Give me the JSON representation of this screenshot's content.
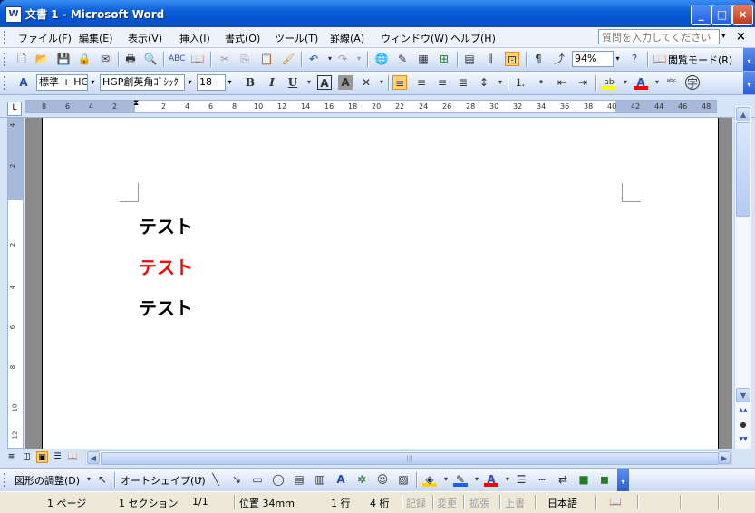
{
  "window": {
    "title": "文書 1 - Microsoft Word",
    "app_icon": "W"
  },
  "titlebar_buttons": {
    "minimize": "_",
    "maximize": "□",
    "close": "×"
  },
  "menu": {
    "items": [
      "ファイル(F)",
      "編集(E)",
      "表示(V)",
      "挿入(I)",
      "書式(O)",
      "ツール(T)",
      "罫線(A)",
      "ウィンドウ(W)",
      "ヘルプ(H)"
    ],
    "ask_placeholder": "質問を入力してください",
    "ask_arrow": "▾",
    "close_doc": "×"
  },
  "standard_toolbar": {
    "zoom": "94%",
    "reading_mode": "閲覧モード(R)"
  },
  "format_toolbar": {
    "style": "標準 + HG",
    "font": "HGP創英角ｺﾞｼｯｸ",
    "size": "18",
    "bold": "B",
    "italic": "I",
    "underline": "U",
    "char_border": "A",
    "char_shade": "A",
    "highlight_color": "#ffff00",
    "font_color": "#ff0000"
  },
  "ruler": {
    "left_numbers": [
      "8",
      "6",
      "4",
      "2"
    ],
    "right_numbers": [
      "2",
      "4",
      "6",
      "8",
      "10",
      "12",
      "14",
      "16",
      "18",
      "20",
      "22",
      "24",
      "26",
      "28",
      "30",
      "32",
      "34",
      "36",
      "38",
      "40",
      "42",
      "44",
      "46",
      "48"
    ],
    "tab_selector": "L",
    "vertical_numbers": [
      "4",
      "2",
      "2",
      "4",
      "6",
      "8",
      "10",
      "12"
    ]
  },
  "document": {
    "lines": [
      {
        "text": "テスト",
        "color": "#000000"
      },
      {
        "text": "テスト",
        "color": "#ff0000"
      },
      {
        "text": "テスト",
        "color": "#000000"
      }
    ]
  },
  "scrollbar": {
    "up": "▲",
    "down": "▼",
    "prev_page": "▲▲",
    "select_browse": "●",
    "next_page": "▼▼",
    "left": "◀",
    "right": "▶",
    "grip": "|||"
  },
  "drawing_toolbar": {
    "draw_menu": "図形の調整(D)",
    "autoshapes": "オートシェイプ(U)",
    "fill_color": "#ffd700",
    "line_color": "#2060e0",
    "font_color": "#ff0000"
  },
  "status_bar": {
    "page": "1 ページ",
    "section": "1 セクション",
    "page_of": "1/1",
    "position": "位置 34mm",
    "line": "1 行",
    "column": "4 桁",
    "rec": "記録",
    "trk": "変更",
    "ext": "拡張",
    "ovr": "上書",
    "language": "日本語"
  }
}
